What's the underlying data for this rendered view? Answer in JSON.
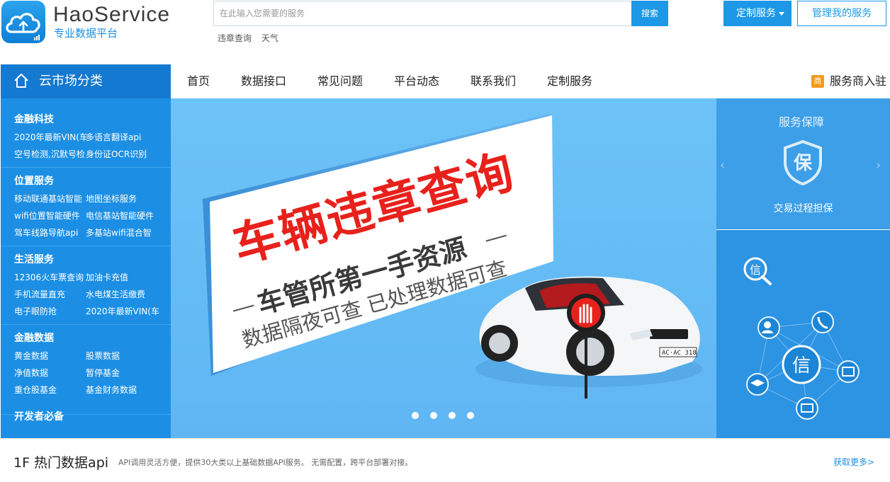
{
  "header": {
    "brand": "HaoService",
    "tagline": "专业数据平台",
    "search_placeholder": "在此输入您需要的服务",
    "search_button": "搜索",
    "hot_links": [
      "违章查询",
      "天气"
    ],
    "custom_service_button": "定制服务",
    "manage_service_button": "管理我的服务"
  },
  "nav": {
    "category_title": "云市场分类",
    "items": [
      "首页",
      "数据接口",
      "常见问题",
      "平台动态",
      "联系我们",
      "定制服务"
    ],
    "merchant_icon_text": "商",
    "merchant_label": "服务商入驻"
  },
  "sidebar": {
    "groups": [
      {
        "title": "金融科技",
        "links": [
          "2020年最新VIN(车",
          "多语言翻译api",
          "空号检测,沉默号检",
          "身份证OCR识别"
        ]
      },
      {
        "title": "位置服务",
        "links": [
          "移动联通基站智能",
          "地图坐标服务",
          "wifi位置智能硬件",
          "电信基站智能硬件",
          "驾车线路导航api",
          "多基站wifi混合智"
        ]
      },
      {
        "title": "生活服务",
        "links": [
          "12306火车票查询",
          "加油卡充值",
          "手机流量直充",
          "水电煤生活缴费",
          "电子眼防抢",
          "2020年最新VIN(车"
        ]
      },
      {
        "title": "金融数据",
        "links": [
          "黄金数据",
          "股票数据",
          "净值数据",
          "暂停基金",
          "重仓股基金",
          "基金财务数据"
        ]
      },
      {
        "title": "开发者必备",
        "links": []
      }
    ]
  },
  "banner": {
    "headline": "车辆违章查询",
    "subline": "车管所第一手资源",
    "detail": "数据隔夜可查 已处理数据可查",
    "plate": "AC·AC 318",
    "slide_count": 4
  },
  "guarantee": {
    "title": "服务保障",
    "badge_char": "保",
    "subtitle": "交易过程担保",
    "prev_arrow": "‹",
    "next_arrow": "›"
  },
  "credit": {
    "center_char": "信",
    "search_char": "信"
  },
  "floor": {
    "title": "1F 热门数据api",
    "description": "API调用灵活方便，提供30大类以上基础数据API服务。 无需配置，跨平台部署对接。",
    "more_link": "获取更多>"
  },
  "colors": {
    "primary": "#1c98e6",
    "sidebar": "#1c8fe5",
    "category_header": "#1479d0",
    "banner_red": "#e8211c"
  }
}
